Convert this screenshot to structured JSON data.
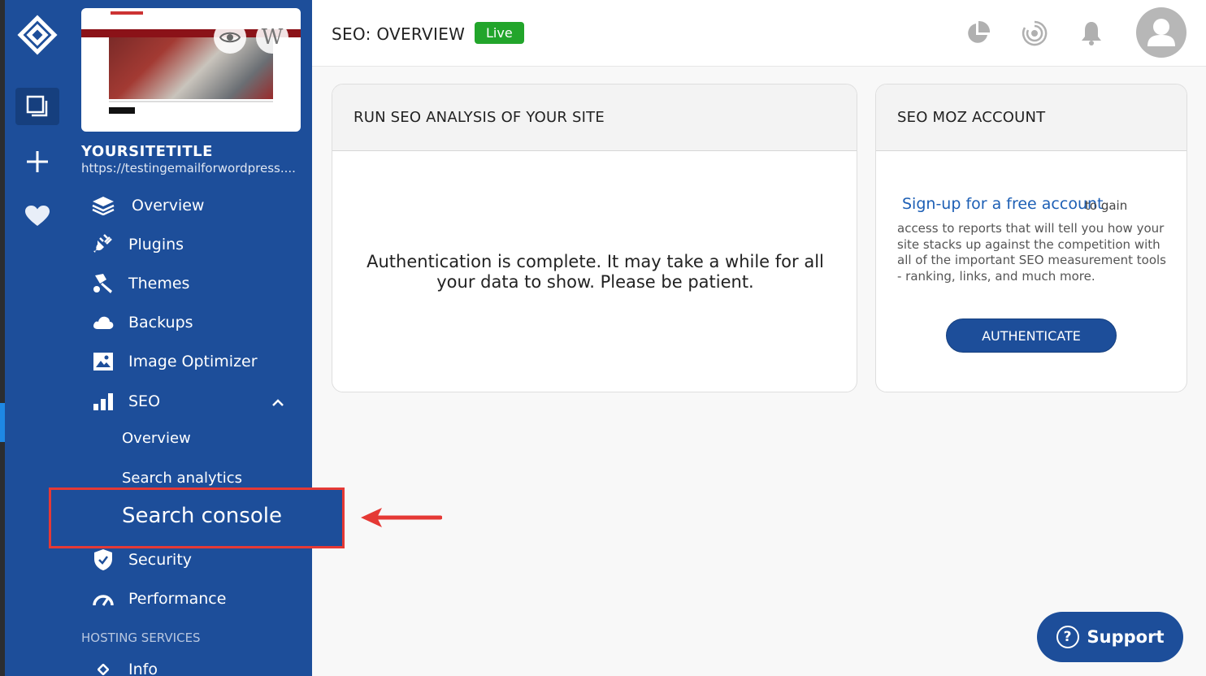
{
  "site": {
    "title": "YOURSITETITLE",
    "url": "https://testingemailforwordpress...."
  },
  "sidebar": {
    "items": [
      {
        "label": "Overview",
        "icon": "layers-icon"
      },
      {
        "label": "Plugins",
        "icon": "plug-icon"
      },
      {
        "label": "Themes",
        "icon": "brush-icon"
      },
      {
        "label": "Backups",
        "icon": "cloud-icon"
      },
      {
        "label": "Image Optimizer",
        "icon": "image-icon"
      },
      {
        "label": "SEO",
        "icon": "bar-chart-icon",
        "expanded": true
      },
      {
        "label": "Security",
        "icon": "shield-icon"
      },
      {
        "label": "Performance",
        "icon": "gauge-icon"
      }
    ],
    "seo_sub": [
      "Overview",
      "Search analytics",
      "Search console"
    ],
    "section_label": "HOSTING SERVICES",
    "info_label": "Info"
  },
  "header": {
    "title": "SEO: OVERVIEW",
    "status_badge": "Live"
  },
  "seo_analysis": {
    "title": "RUN SEO ANALYSIS OF YOUR SITE",
    "message": "Authentication is complete. It may take a while for all your data to show. Please be patient."
  },
  "moz": {
    "title": "SEO MOZ ACCOUNT",
    "link": "Sign-up for a free account",
    "link_suffix": "to gain",
    "description": "access to reports that will tell you how your site stacks up against the competition with all of the important SEO measurement tools - ranking, links, and much more.",
    "button": "AUTHENTICATE"
  },
  "support": {
    "label": "Support"
  },
  "colors": {
    "brand": "#1d4e9a",
    "live": "#22a52b",
    "highlight": "#e53935"
  }
}
